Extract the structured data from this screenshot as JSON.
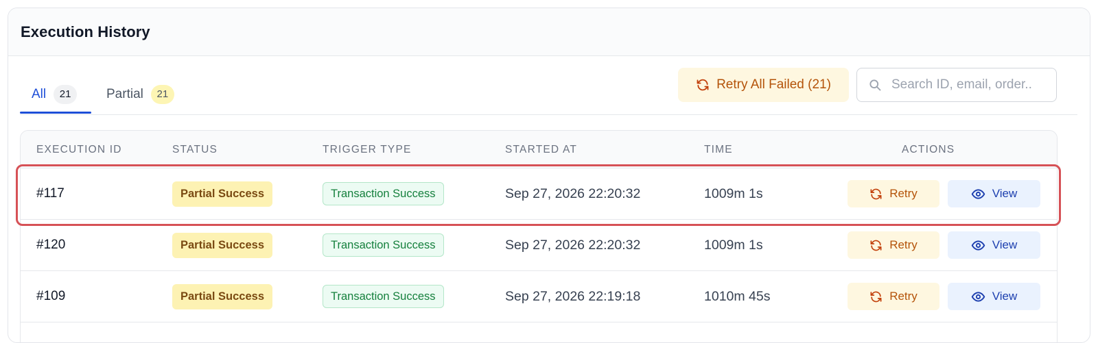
{
  "panel": {
    "title": "Execution History"
  },
  "tabs": [
    {
      "label": "All",
      "count": "21",
      "active": true
    },
    {
      "label": "Partial",
      "count": "21",
      "active": false
    }
  ],
  "toolbar": {
    "retry_all_label": "Retry All Failed (21)",
    "search_placeholder": "Search ID, email, order.."
  },
  "table": {
    "headers": {
      "id": "EXECUTION ID",
      "status": "STATUS",
      "trigger": "TRIGGER TYPE",
      "started": "STARTED AT",
      "time": "TIME",
      "actions": "ACTIONS"
    },
    "rows": [
      {
        "id": "#117",
        "status": "Partial Success",
        "trigger": "Transaction Success",
        "started": "Sep 27, 2026 22:20:32",
        "time": "1009m 1s"
      },
      {
        "id": "#120",
        "status": "Partial Success",
        "trigger": "Transaction Success",
        "started": "Sep 27, 2026 22:20:32",
        "time": "1009m 1s"
      },
      {
        "id": "#109",
        "status": "Partial Success",
        "trigger": "Transaction Success",
        "started": "Sep 27, 2026 22:19:18",
        "time": "1010m 45s"
      }
    ],
    "actions": {
      "retry_label": "Retry",
      "view_label": "View"
    }
  },
  "icons": {
    "retry": "refresh-icon",
    "search": "search-icon",
    "view": "eye-icon"
  },
  "colors": {
    "accent": "#1d4ed8",
    "warning": "#b45309",
    "success": "#15803d",
    "highlight": "#d65156"
  }
}
